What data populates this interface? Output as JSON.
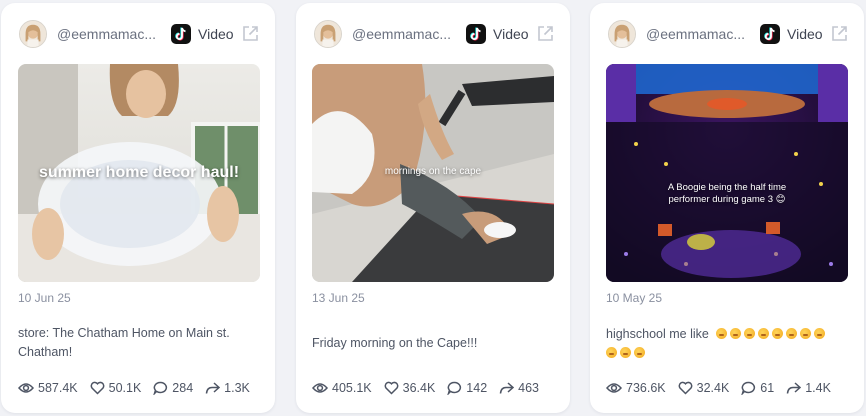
{
  "cards": [
    {
      "handle": "@eemmamac...",
      "platform": "Video",
      "media_caption": "summer home decor haul!",
      "date": "10 Jun 25",
      "description": "store: The Chatham Home on Main st. Chatham!",
      "views": "587.4K",
      "likes": "50.1K",
      "comments": "284",
      "shares": "1.3K"
    },
    {
      "handle": "@eemmamac...",
      "platform": "Video",
      "media_caption": "mornings on the cape",
      "date": "13 Jun 25",
      "description": "Friday morning on the Cape!!!",
      "views": "405.1K",
      "likes": "36.4K",
      "comments": "142",
      "shares": "463"
    },
    {
      "handle": "@eemmamac...",
      "platform": "Video",
      "media_caption": "A Boogie being the half time performer during game 3 😊",
      "date": "10 May 25",
      "description": "highschool me like",
      "emoji_count": 11,
      "views": "736.6K",
      "likes": "32.4K",
      "comments": "61",
      "shares": "1.4K"
    }
  ],
  "icons": {
    "avatar": "avatar",
    "platform": "tiktok-icon",
    "external": "external-link-icon",
    "views": "eye-icon",
    "likes": "heart-icon",
    "comments": "comment-icon",
    "shares": "share-icon"
  },
  "colors": {
    "background": "#f1f2f6",
    "card": "#ffffff",
    "text": "#4e5564",
    "muted": "#8a90a0"
  }
}
